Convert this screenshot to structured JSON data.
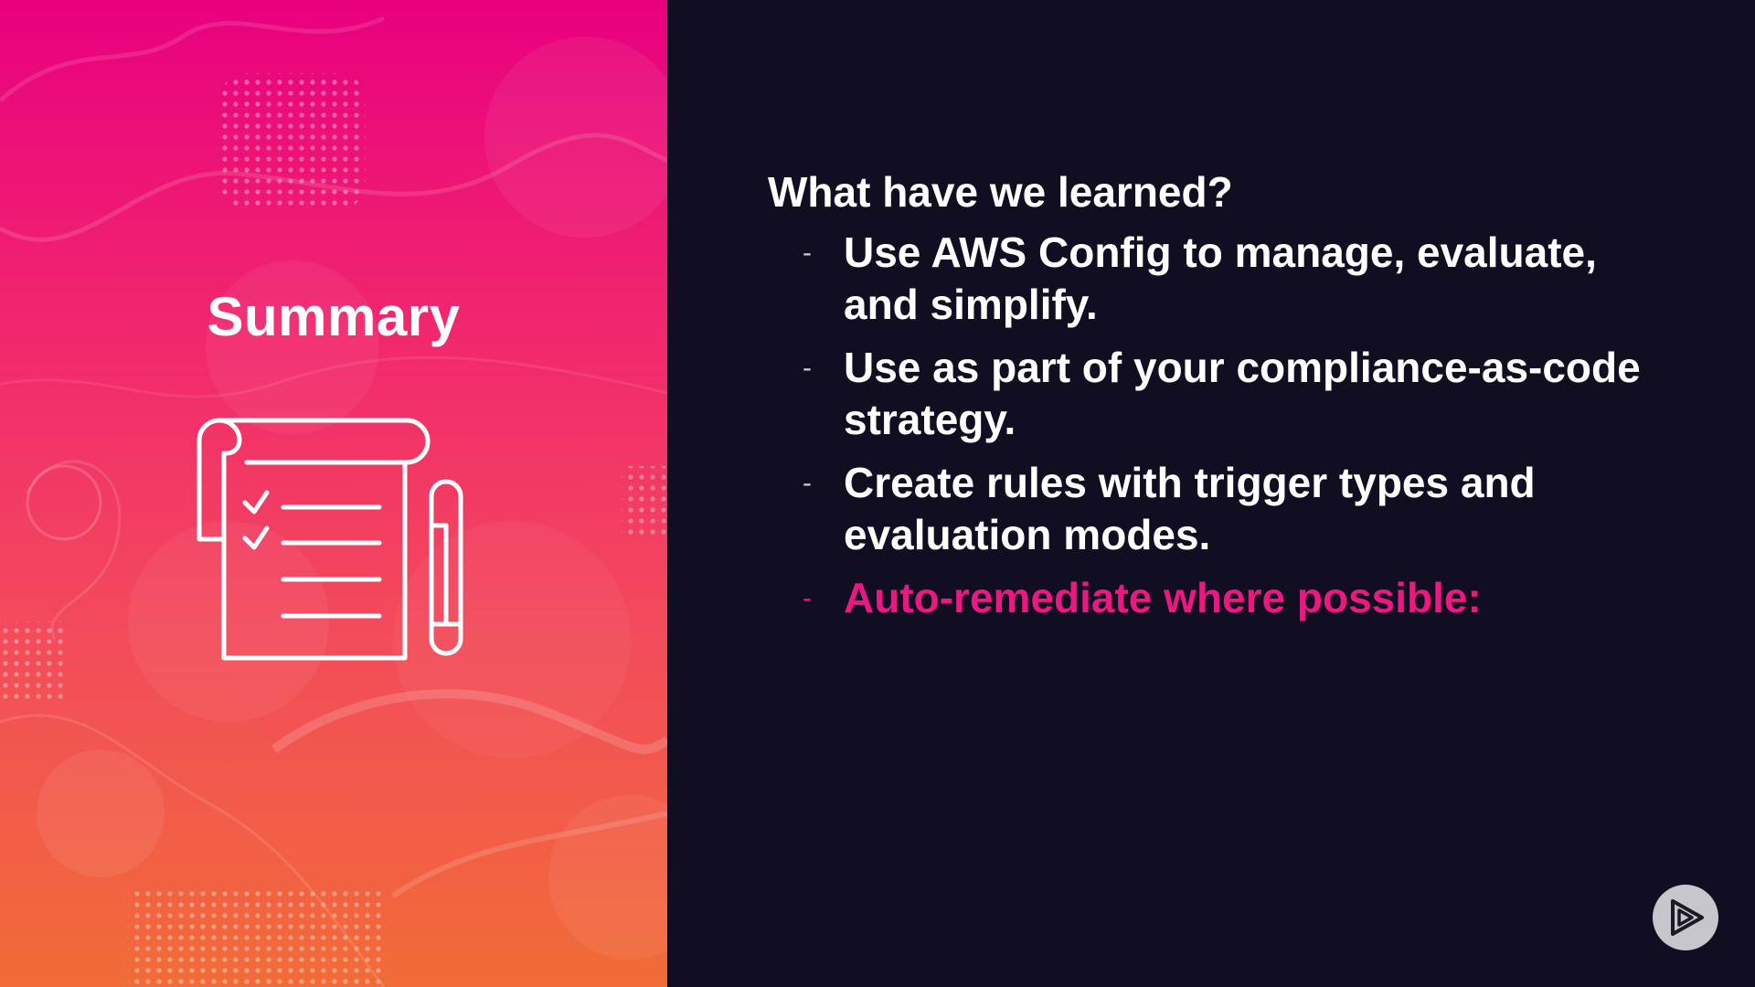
{
  "slide": {
    "panel_title": "Summary",
    "heading": "What have we learned?",
    "bullets": [
      {
        "dash": "-",
        "text": "Use AWS Config to manage, evaluate, and simplify."
      },
      {
        "dash": "-",
        "text": "Use as part of your compliance-as-code strategy."
      },
      {
        "dash": "-",
        "text": "Create rules with trigger types and evaluation modes."
      },
      {
        "dash": "-",
        "text": "Auto-remediate where possible:"
      }
    ]
  },
  "icons": {
    "panel_icon": "checklist-with-pen-icon",
    "logo": "pluralsight-play-icon"
  },
  "colors": {
    "background": "#110e22",
    "accent": "#ec1882",
    "gradient_top": "#e8007f",
    "gradient_bottom": "#f16c37",
    "text": "#ffffff"
  }
}
